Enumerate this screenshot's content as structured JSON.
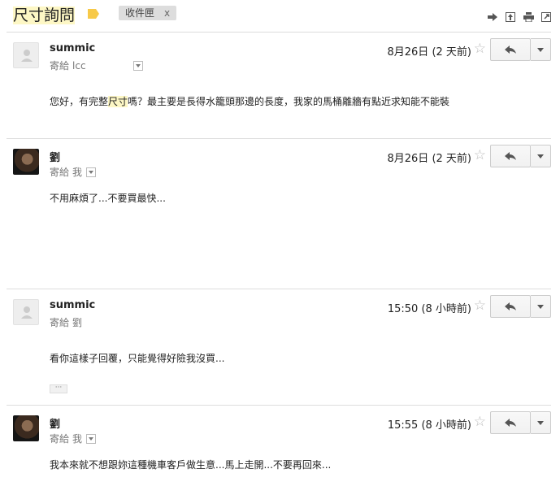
{
  "thread": {
    "subject": "尺寸詢問",
    "inbox_label": "收件匣",
    "inbox_remove": "x",
    "label_color": "#f7c948"
  },
  "toolbar": {
    "icons": [
      "forward-icon",
      "expand-icon",
      "print-icon",
      "new-window-icon"
    ]
  },
  "messages": [
    {
      "sender": "summic",
      "to_prefix": "寄給",
      "to_name": "lcc",
      "date": "8月26日",
      "relative": "(2 天前)",
      "body_before": "您好，有完整",
      "body_highlight": "尺寸",
      "body_after": "嗎？最主要是長得水籠頭那邊的長度，我家的馬桶離牆有點近求知能不能裝",
      "avatar": "blank"
    },
    {
      "sender": "劉",
      "to_prefix": "寄給",
      "to_name": "我",
      "date": "8月26日",
      "relative": "(2 天前)",
      "body": "不用麻煩了...不要買最快...",
      "avatar": "photo"
    },
    {
      "sender": "summic",
      "to_prefix": "寄給",
      "to_name": "劉",
      "date": "15:50",
      "relative": "(8 小時前)",
      "body": "看你這樣子回覆，只能覺得好險我沒買...",
      "show_trimmed": "···",
      "avatar": "blank"
    },
    {
      "sender": "劉",
      "to_prefix": "寄給",
      "to_name": "我",
      "date": "15:55",
      "relative": "(8 小時前)",
      "body": "我本來就不想跟妳這種機車客戶做生意...馬上走開...不要再回來...",
      "avatar": "photo"
    }
  ]
}
